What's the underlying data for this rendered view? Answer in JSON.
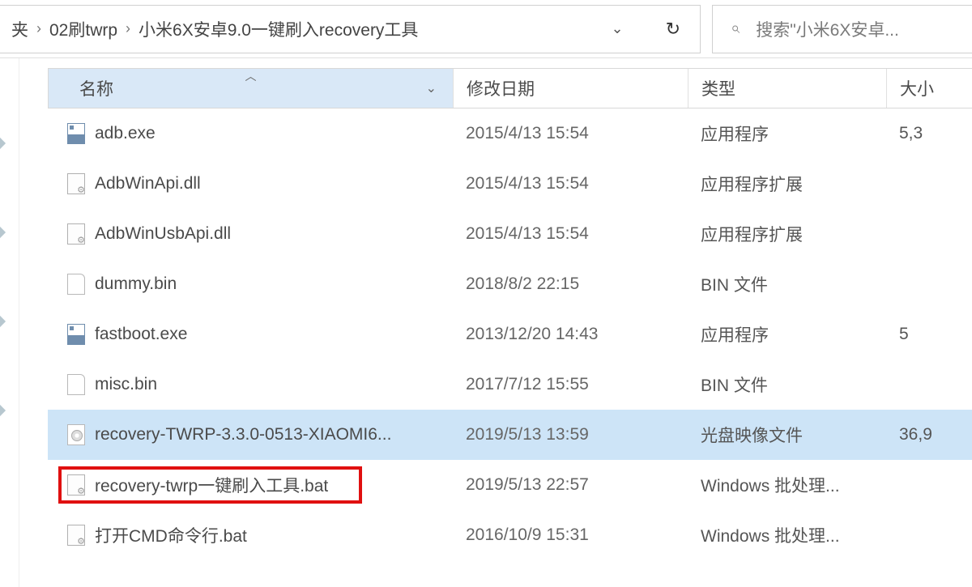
{
  "breadcrumb": {
    "items": [
      "夹",
      "02刷twrp",
      "小米6X安卓9.0一键刷入recovery工具"
    ]
  },
  "search": {
    "placeholder": "搜索\"小米6X安卓..."
  },
  "columns": {
    "name": "名称",
    "date": "修改日期",
    "type": "类型",
    "size": "大小"
  },
  "files": [
    {
      "icon": "exe",
      "name": "adb.exe",
      "date": "2015/4/13 15:54",
      "type": "应用程序",
      "size": "5,3",
      "selected": false,
      "highlighted": false
    },
    {
      "icon": "dll",
      "name": "AdbWinApi.dll",
      "date": "2015/4/13 15:54",
      "type": "应用程序扩展",
      "size": "",
      "selected": false,
      "highlighted": false
    },
    {
      "icon": "dll",
      "name": "AdbWinUsbApi.dll",
      "date": "2015/4/13 15:54",
      "type": "应用程序扩展",
      "size": "",
      "selected": false,
      "highlighted": false
    },
    {
      "icon": "bin",
      "name": "dummy.bin",
      "date": "2018/8/2 22:15",
      "type": "BIN 文件",
      "size": "",
      "selected": false,
      "highlighted": false
    },
    {
      "icon": "exe",
      "name": "fastboot.exe",
      "date": "2013/12/20 14:43",
      "type": "应用程序",
      "size": "5",
      "selected": false,
      "highlighted": false
    },
    {
      "icon": "bin",
      "name": "misc.bin",
      "date": "2017/7/12 15:55",
      "type": "BIN 文件",
      "size": "",
      "selected": false,
      "highlighted": false
    },
    {
      "icon": "iso",
      "name": "recovery-TWRP-3.3.0-0513-XIAOMI6...",
      "date": "2019/5/13 13:59",
      "type": "光盘映像文件",
      "size": "36,9",
      "selected": true,
      "highlighted": false
    },
    {
      "icon": "bat",
      "name": "recovery-twrp一键刷入工具.bat",
      "date": "2019/5/13 22:57",
      "type": "Windows 批处理...",
      "size": "",
      "selected": false,
      "highlighted": true
    },
    {
      "icon": "bat",
      "name": "打开CMD命令行.bat",
      "date": "2016/10/9 15:31",
      "type": "Windows 批处理...",
      "size": "",
      "selected": false,
      "highlighted": false
    }
  ]
}
